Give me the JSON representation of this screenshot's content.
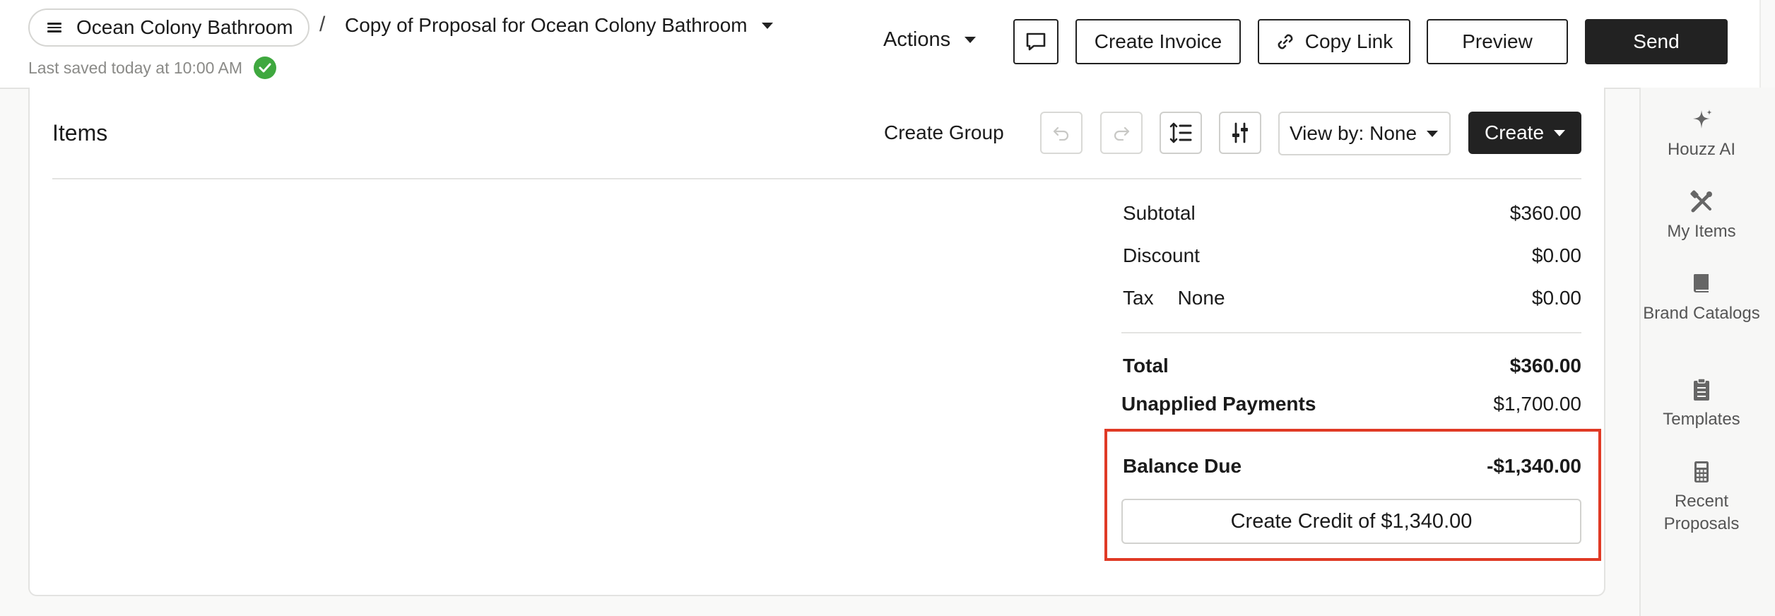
{
  "header": {
    "project_name": "Ocean Colony Bathroom",
    "separator": "/",
    "document_title": "Copy of Proposal for Ocean Colony Bathroom",
    "saved_status": "Last saved today at 10:00 AM",
    "actions_label": "Actions",
    "create_invoice_label": "Create Invoice",
    "copy_link_label": "Copy Link",
    "preview_label": "Preview",
    "send_label": "Send"
  },
  "items": {
    "title": "Items",
    "create_group_label": "Create Group",
    "view_by_label": "View by: None",
    "create_label": "Create"
  },
  "totals": {
    "subtotal_label": "Subtotal",
    "subtotal_value": "$360.00",
    "discount_label": "Discount",
    "discount_value": "$0.00",
    "tax_label": "Tax",
    "tax_rate": "None",
    "tax_value": "$0.00",
    "total_label": "Total",
    "total_value": "$360.00",
    "unapplied_label": "Unapplied Payments",
    "unapplied_value": "$1,700.00",
    "balance_label": "Balance Due",
    "balance_value": "-$1,340.00",
    "credit_button_label": "Create Credit of $1,340.00"
  },
  "rail": {
    "houzz_ai": "Houzz AI",
    "my_items": "My Items",
    "brand_catalogs": "Brand Catalogs",
    "templates": "Templates",
    "recent_proposals": "Recent Proposals"
  },
  "colors": {
    "highlight": "#e03a25",
    "success": "#3fa83f",
    "primary_button": "#222222"
  }
}
